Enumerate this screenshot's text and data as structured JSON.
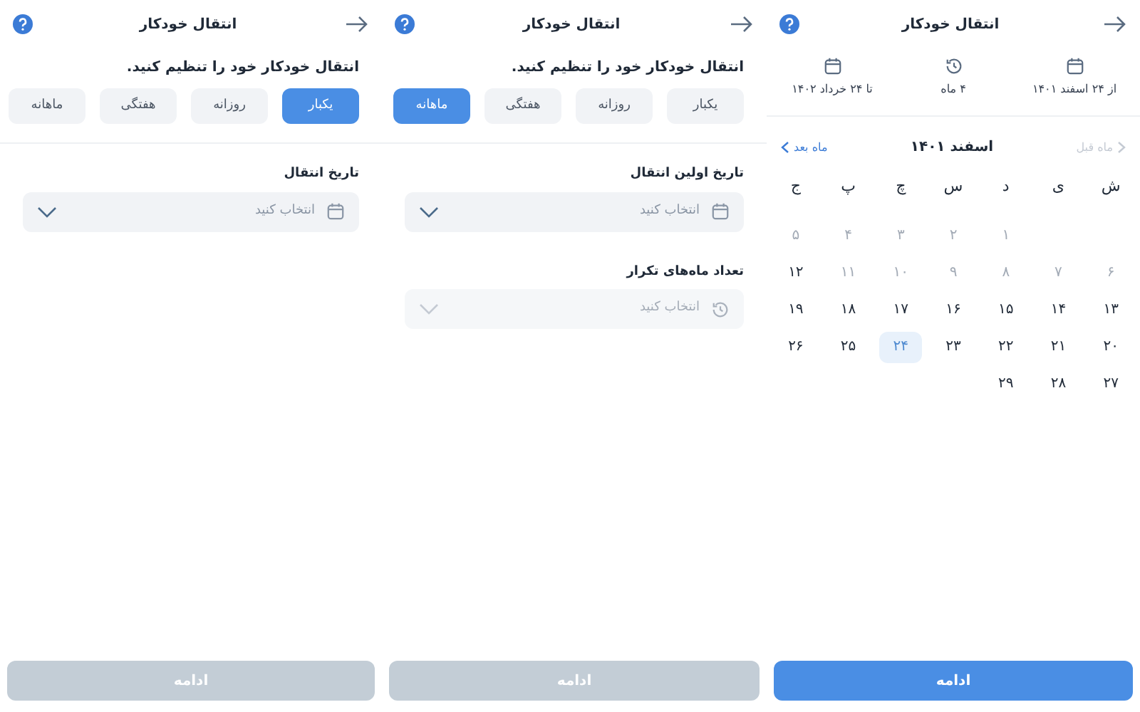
{
  "screens": [
    {
      "kind": "calendar",
      "title": "انتقال خودکار",
      "summary": [
        {
          "kind": "date",
          "text": "از ۲۴ اسفند ۱۴۰۱"
        },
        {
          "kind": "duration",
          "text": "۴ ماه"
        },
        {
          "kind": "date",
          "text": "تا ۲۴ خرداد ۱۴۰۲"
        }
      ],
      "month": "اسفند ۱۴۰۱",
      "prev": {
        "label": "ماه قبل",
        "disabled": true
      },
      "next": {
        "label": "ماه بعد",
        "disabled": false
      },
      "weekdays": [
        "ش",
        "ی",
        "د",
        "س",
        "چ",
        "پ",
        "ج"
      ],
      "weeks": [
        [
          {
            "kind": "blank"
          },
          {
            "kind": "blank"
          },
          {
            "kind": "day",
            "label": "۱",
            "disabled": true,
            "selected": false
          },
          {
            "kind": "day",
            "label": "۲",
            "disabled": true,
            "selected": false
          },
          {
            "kind": "day",
            "label": "۳",
            "disabled": true,
            "selected": false
          },
          {
            "kind": "day",
            "label": "۴",
            "disabled": true,
            "selected": false
          },
          {
            "kind": "day",
            "label": "۵",
            "disabled": true,
            "selected": false
          }
        ],
        [
          {
            "kind": "day",
            "label": "۶",
            "disabled": true,
            "selected": false
          },
          {
            "kind": "day",
            "label": "۷",
            "disabled": true,
            "selected": false
          },
          {
            "kind": "day",
            "label": "۸",
            "disabled": true,
            "selected": false
          },
          {
            "kind": "day",
            "label": "۹",
            "disabled": true,
            "selected": false
          },
          {
            "kind": "day",
            "label": "۱۰",
            "disabled": true,
            "selected": false
          },
          {
            "kind": "day",
            "label": "۱۱",
            "disabled": true,
            "selected": false
          },
          {
            "kind": "day",
            "label": "۱۲",
            "disabled": false,
            "selected": false
          }
        ],
        [
          {
            "kind": "day",
            "label": "۱۳",
            "disabled": false,
            "selected": false
          },
          {
            "kind": "day",
            "label": "۱۴",
            "disabled": false,
            "selected": false
          },
          {
            "kind": "day",
            "label": "۱۵",
            "disabled": false,
            "selected": false
          },
          {
            "kind": "day",
            "label": "۱۶",
            "disabled": false,
            "selected": false
          },
          {
            "kind": "day",
            "label": "۱۷",
            "disabled": false,
            "selected": false
          },
          {
            "kind": "day",
            "label": "۱۸",
            "disabled": false,
            "selected": false
          },
          {
            "kind": "day",
            "label": "۱۹",
            "disabled": false,
            "selected": false
          }
        ],
        [
          {
            "kind": "day",
            "label": "۲۰",
            "disabled": false,
            "selected": false
          },
          {
            "kind": "day",
            "label": "۲۱",
            "disabled": false,
            "selected": false
          },
          {
            "kind": "day",
            "label": "۲۲",
            "disabled": false,
            "selected": false
          },
          {
            "kind": "day",
            "label": "۲۳",
            "disabled": false,
            "selected": false
          },
          {
            "kind": "day",
            "label": "۲۴",
            "disabled": false,
            "selected": true
          },
          {
            "kind": "day",
            "label": "۲۵",
            "disabled": false,
            "selected": false
          },
          {
            "kind": "day",
            "label": "۲۶",
            "disabled": false,
            "selected": false
          }
        ],
        [
          {
            "kind": "day",
            "label": "۲۷",
            "disabled": false,
            "selected": false
          },
          {
            "kind": "day",
            "label": "۲۸",
            "disabled": false,
            "selected": false
          },
          {
            "kind": "day",
            "label": "۲۹",
            "disabled": false,
            "selected": false
          }
        ]
      ],
      "continue": {
        "label": "ادامه",
        "disabled": false
      }
    },
    {
      "kind": "form",
      "title": "انتقال خودکار",
      "prompt": "انتقال خودکار خود را تنظیم کنید.",
      "options": [
        {
          "label": "یکبار",
          "selected": false
        },
        {
          "label": "روزانه",
          "selected": false
        },
        {
          "label": "هفتگی",
          "selected": false
        },
        {
          "label": "ماهانه",
          "selected": true
        }
      ],
      "fields": [
        {
          "kind": "date",
          "label": "تاریخ اولین انتقال",
          "placeholder": "انتخاب کنید",
          "disabled": false
        },
        {
          "kind": "duration",
          "label": "تعداد ماه‌های تکرار",
          "placeholder": "انتخاب کنید",
          "disabled": true
        }
      ],
      "continue": {
        "label": "ادامه",
        "disabled": true
      }
    },
    {
      "kind": "form",
      "title": "انتقال خودکار",
      "prompt": "انتقال خودکار خود را تنظیم کنید.",
      "options": [
        {
          "label": "یکبار",
          "selected": true
        },
        {
          "label": "روزانه",
          "selected": false
        },
        {
          "label": "هفتگی",
          "selected": false
        },
        {
          "label": "ماهانه",
          "selected": false
        }
      ],
      "fields": [
        {
          "kind": "date",
          "label": "تاریخ انتقال",
          "placeholder": "انتخاب کنید",
          "disabled": false
        }
      ],
      "continue": {
        "label": "ادامه",
        "disabled": true
      }
    }
  ]
}
